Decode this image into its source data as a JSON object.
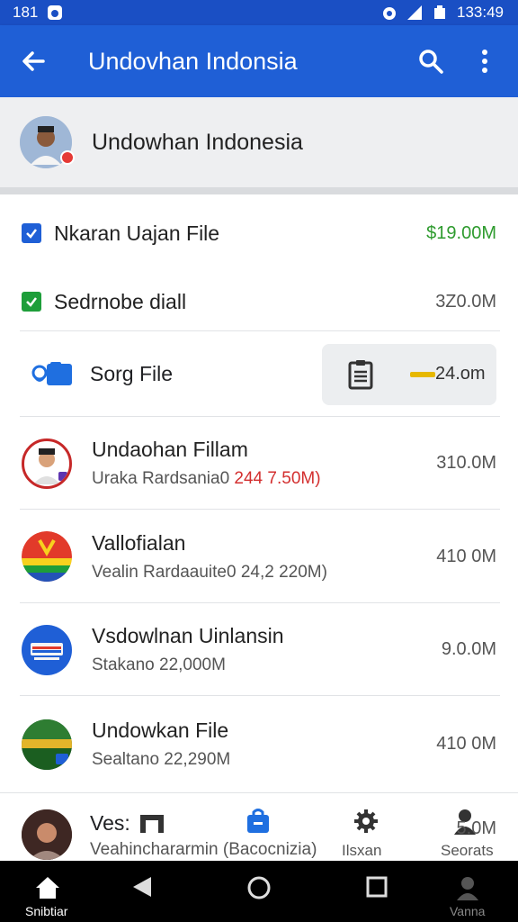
{
  "status_bar": {
    "time_left": "181",
    "time_right": "133:49"
  },
  "app_bar": {
    "title": "Undovhan Indonsia",
    "back_icon": "arrow-back-icon",
    "search_icon": "search-icon",
    "more_icon": "more-vert-icon"
  },
  "account": {
    "name": "Undowhan Indonesia"
  },
  "checks": [
    {
      "label": "Nkaran Uajan File",
      "size": "$19.00M",
      "size_color": "#2e9b2e",
      "box_color": "#1f5fd6"
    },
    {
      "label": "Sedrnobe diall",
      "size": "3Z0.0M",
      "size_color": "#555555",
      "box_color": "#1e9e3a"
    }
  ],
  "file": {
    "label": "Sorg File",
    "chip_size": "24.om"
  },
  "items": [
    {
      "title": "Undaohan Fillam",
      "sub": "Uraka Rardsania0",
      "sub_red": "244 7.50M)",
      "size": "310.0M"
    },
    {
      "title": "Vallofialan",
      "sub": "Vealin Rardaauite0 24,2 220M)",
      "sub_red": "",
      "size": "410 0M"
    },
    {
      "title": "Vsdowlnan Uinlansin",
      "sub": "Stakano 22,000M",
      "sub_red": "",
      "size": "9.0.0M"
    },
    {
      "title": "Undowkan File",
      "sub": "Sealtano 22,290M",
      "sub_red": "",
      "size": "410 0M"
    }
  ],
  "bottom_row": {
    "title": "Ves:",
    "sub": "Veahinchararmin (Bacocnizia)",
    "tabs": [
      {
        "label": "Ilsxan"
      },
      {
        "label": "Seorats"
      }
    ],
    "size": "5.0M"
  },
  "navbar": {
    "home_label": "Snibtiar",
    "profile_label": "Vanna"
  }
}
